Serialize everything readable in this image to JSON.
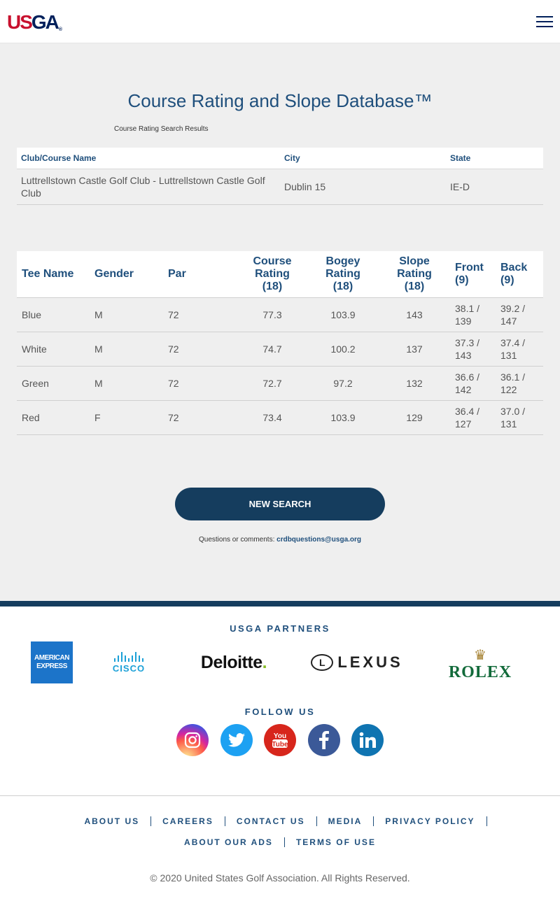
{
  "header": {
    "logo_text_us": "US",
    "logo_text_ga": "GA",
    "logo_reg": "®",
    "menu_icon": "hamburger-menu-icon"
  },
  "main": {
    "title": "Course Rating and Slope Database™",
    "results_caption": "Course Rating Search Results",
    "club_table": {
      "headers": [
        "Club/Course Name",
        "City",
        "State"
      ],
      "rows": [
        {
          "name": "Luttrellstown Castle Golf Club - Luttrellstown Castle Golf Club",
          "city": "Dublin 15",
          "state": "IE-D"
        }
      ]
    },
    "tee_table": {
      "headers": {
        "tee_name": "Tee Name",
        "gender": "Gender",
        "par": "Par",
        "course_rating_1": "Course",
        "course_rating_2": "Rating",
        "course_rating_3": "(18)",
        "bogey_rating_1": "Bogey",
        "bogey_rating_2": "Rating",
        "bogey_rating_3": "(18)",
        "slope_rating_1": "Slope",
        "slope_rating_2": "Rating",
        "slope_rating_3": "(18)",
        "front_1": "Front",
        "front_2": "(9)",
        "back_1": "Back",
        "back_2": "(9)"
      },
      "rows": [
        {
          "tee": "Blue",
          "gender": "M",
          "par": "72",
          "course_rating": "77.3",
          "bogey_rating": "103.9",
          "slope_rating": "143",
          "front_1": "38.1 /",
          "front_2": "139",
          "back_1": "39.2 /",
          "back_2": "147"
        },
        {
          "tee": "White",
          "gender": "M",
          "par": "72",
          "course_rating": "74.7",
          "bogey_rating": "100.2",
          "slope_rating": "137",
          "front_1": "37.3 /",
          "front_2": "143",
          "back_1": "37.4 /",
          "back_2": "131"
        },
        {
          "tee": "Green",
          "gender": "M",
          "par": "72",
          "course_rating": "72.7",
          "bogey_rating": "97.2",
          "slope_rating": "132",
          "front_1": "36.6 /",
          "front_2": "142",
          "back_1": "36.1 /",
          "back_2": "122"
        },
        {
          "tee": "Red",
          "gender": "F",
          "par": "72",
          "course_rating": "73.4",
          "bogey_rating": "103.9",
          "slope_rating": "129",
          "front_1": "36.4 /",
          "front_2": "127",
          "back_1": "37.0 /",
          "back_2": "131"
        }
      ]
    },
    "new_search_label": "NEW SEARCH",
    "contact_prefix": "Questions or comments: ",
    "contact_email": "crdbquestions@usga.org"
  },
  "footer": {
    "partners_title": "USGA PARTNERS",
    "partners": {
      "amex_1": "AMERICAN",
      "amex_2": "EXPRESS",
      "cisco": "CISCO",
      "deloitte": "Deloitte",
      "deloitte_dot": ".",
      "lexus_mark": "L",
      "lexus": "LEXUS",
      "rolex_crown": "♛",
      "rolex": "ROLEX"
    },
    "follow_title": "FOLLOW US",
    "social": [
      "instagram-icon",
      "twitter-icon",
      "youtube-icon",
      "facebook-icon",
      "linkedin-icon"
    ],
    "links_row1": [
      "ABOUT US",
      "CAREERS",
      "CONTACT US",
      "MEDIA",
      "PRIVACY POLICY"
    ],
    "links_row2": [
      "ABOUT OUR ADS",
      "TERMS OF USE"
    ],
    "copyright": "© 2020 United States Golf Association. All Rights Reserved."
  },
  "colors": {
    "brand_red": "#c8102e",
    "brand_navy": "#00205b",
    "heading_blue": "#1f4f7c",
    "button_navy": "#153d5e",
    "background_gray": "#efefef"
  }
}
